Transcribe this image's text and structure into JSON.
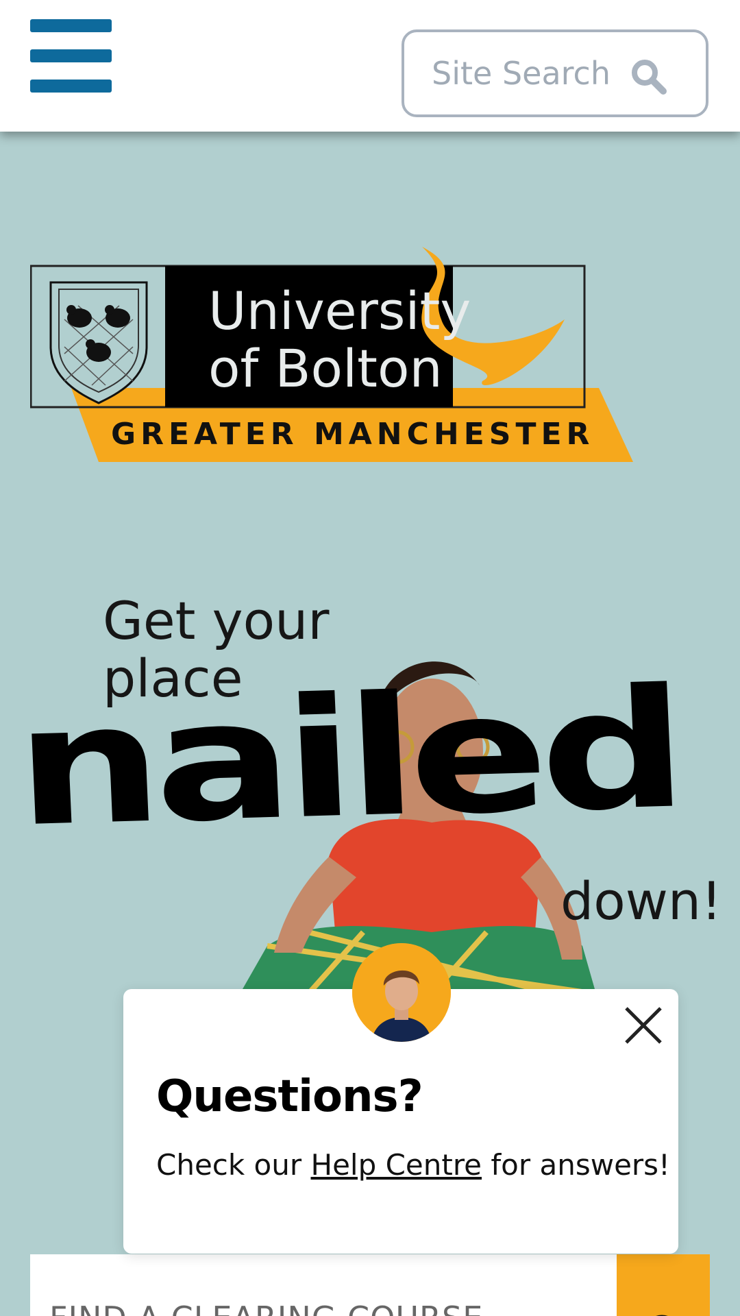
{
  "header": {
    "search_placeholder": "Site Search"
  },
  "logo": {
    "name_line1": "University",
    "name_line2": "of Bolton",
    "region": "GREATER MANCHESTER"
  },
  "hero": {
    "line1": "Get your",
    "line2": "place",
    "big_word": "nailed",
    "line3": "down!"
  },
  "popup": {
    "title": "Questions?",
    "text_before": "Check our ",
    "link_label": "Help Centre",
    "text_after": " for answers!"
  },
  "course_finder": {
    "placeholder": "FIND A CLEARING COURSE"
  },
  "colors": {
    "brand_blue": "#0e6a9c",
    "accent_yellow": "#f6a81c",
    "hero_background": "#b1cfcf"
  }
}
